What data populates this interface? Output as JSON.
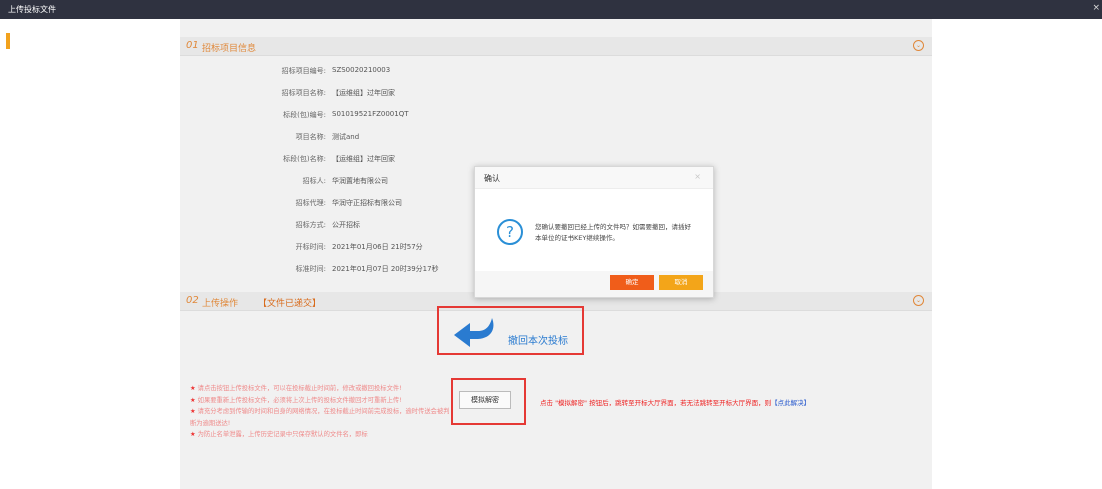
{
  "window": {
    "title": "上传投标文件",
    "close_label": "×"
  },
  "section1": {
    "number": "01",
    "title": "招标项目信息",
    "rows": [
      {
        "label": "招标项目编号:",
        "value": "SZS0020210003"
      },
      {
        "label": "招标项目名称:",
        "value": "【运维组】过年回家"
      },
      {
        "label": "标段(包)编号:",
        "value": "S01019521FZ0001QT"
      },
      {
        "label": "项目名称:",
        "value": "测试and"
      },
      {
        "label": "标段(包)名称:",
        "value": "【运维组】过年回家"
      },
      {
        "label": "招标人:",
        "value": "华润置地有限公司"
      },
      {
        "label": "招标代理:",
        "value": "华润守正招标有限公司"
      },
      {
        "label": "招标方式:",
        "value": "公开招标"
      },
      {
        "label": "开标时间:",
        "value": "2021年01月06日 21时57分"
      },
      {
        "label": "标准时间:",
        "value": "2021年01月07日 20时39分17秒"
      }
    ]
  },
  "section2": {
    "number": "02",
    "title": "上传操作",
    "status": "【文件已递交】",
    "withdraw_label": "撤回本次投标",
    "simulate_button": "模拟解密",
    "hint_prefix": "点击 \"模拟解密\" 按钮后，跳转至开标大厅界面，若无法跳转至开标大厅界面，则",
    "hint_link": "【点此解决】",
    "notes": [
      "请点击按钮上传投标文件，可以在投标截止时间前，修改或撤回投标文件!",
      "如果要重新上传投标文件，必须将上次上传的投标文件撤回才可重新上传!",
      "请充分考虑到传输的时间和自身的网络情况，在投标截止时间前完成投标，逾时传送会被判断为逾期送达!",
      "为防止名单泄露，上传历史记录中只保存默认的文件名，即标"
    ]
  },
  "dialog": {
    "title": "确认",
    "close_label": "×",
    "message": "您确认要撤回已经上传的文件吗？如需要撤回，请插好本单位的证书KEY继续操作。",
    "ok_label": "确定",
    "cancel_label": "取消"
  },
  "colors": {
    "accent": "#e0883a",
    "ok": "#f05d1a",
    "cancel": "#f3a519",
    "link": "#2a7bd0",
    "highlight": "#e53935"
  }
}
